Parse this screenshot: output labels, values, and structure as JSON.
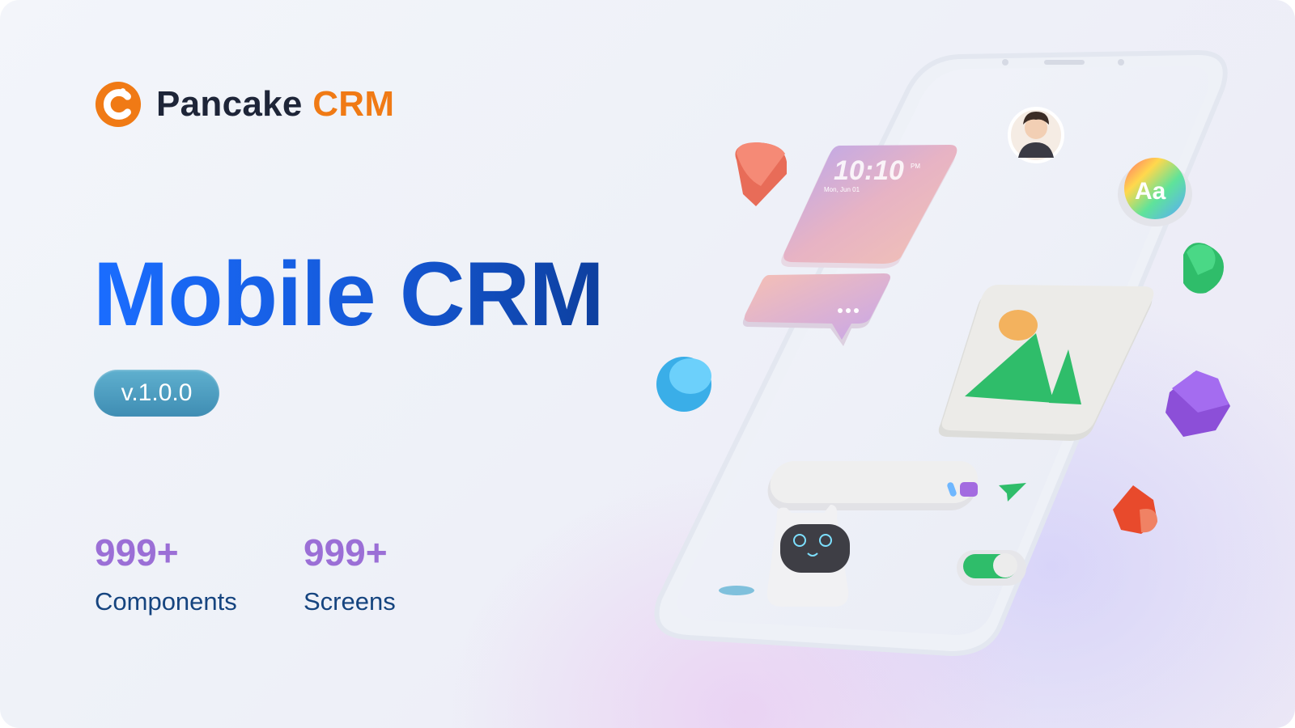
{
  "brand": {
    "name": "Pancake",
    "accent": "CRM",
    "brand_color": "#1e2538",
    "accent_color": "#f07a15"
  },
  "hero": {
    "title": "Mobile CRM",
    "version": "v.1.0.0"
  },
  "stats": [
    {
      "value": "999+",
      "label": "Components"
    },
    {
      "value": "999+",
      "label": "Screens"
    }
  ],
  "illustration": {
    "clock_time": "10:10",
    "clock_ampm": "PM",
    "clock_date": "Mon, Jun 01",
    "font_badge": "Aa"
  }
}
